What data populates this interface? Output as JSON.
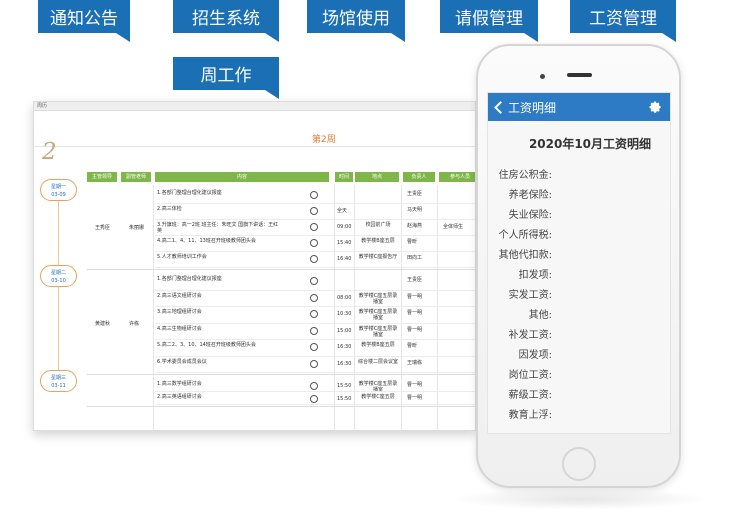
{
  "tags": [
    "通知公告",
    "招生系统",
    "场馆使用",
    "请假管理",
    "工资管理",
    "周工作"
  ],
  "screenshot": {
    "window_title": "周历",
    "week_number": "2",
    "week_label": "第2周",
    "headers": [
      "主管领导",
      "副管老师",
      "内容",
      "时间",
      "地点",
      "负责人",
      "参与人员"
    ],
    "days": [
      {
        "day": "星期一",
        "date": "03-09",
        "leader": "王秀臣",
        "teacher": "朱丽娜",
        "rows": [
          {
            "content": "1.各部门整理台理化建议报座",
            "time": "",
            "place": "",
            "owner": "王贵臣",
            "participants": ""
          },
          {
            "content": "2.高三体检",
            "time": "全天",
            "place": "",
            "owner": "马天明",
            "participants": ""
          },
          {
            "content": "3.升旗班：高一2班 班主任：朱旺文 国旗下讲话：王红英",
            "time": "09:00",
            "place": "校园前广场",
            "owner": "赵海燕",
            "participants": "全体师生"
          },
          {
            "content": "4.高二1、4、11、13班召开班级教师团头会",
            "time": "15:40",
            "place": "教学楼B座五层",
            "owner": "曹昕",
            "participants": ""
          },
          {
            "content": "5.人才教师培训工作会",
            "time": "16:40",
            "place": "教学楼C座报告厅",
            "owner": "田向工",
            "participants": ""
          }
        ]
      },
      {
        "day": "星期二",
        "date": "03-10",
        "leader": "黄建秋",
        "teacher": "许栋",
        "rows": [
          {
            "content": "1.各部门整理台理化建议报座",
            "time": "",
            "place": "",
            "owner": "王贵臣",
            "participants": ""
          },
          {
            "content": "2.高三语文组研讨会",
            "time": "08:00",
            "place": "教学楼C座五层录播室",
            "owner": "曹一明",
            "participants": ""
          },
          {
            "content": "3.高三地理组研讨会",
            "time": "10:30",
            "place": "教学楼C座五层录播室",
            "owner": "曹一明",
            "participants": ""
          },
          {
            "content": "4.高三生物组研讨会",
            "time": "15:00",
            "place": "教学楼C座五层录播室",
            "owner": "曹一明",
            "participants": ""
          },
          {
            "content": "5.高二2、3、10、14班召开班级教师团头会",
            "time": "16:30",
            "place": "教学楼B座五层",
            "owner": "曹昕",
            "participants": ""
          },
          {
            "content": "6.学术委员会成员会议",
            "time": "16:30",
            "place": "综合楼二层会议室",
            "owner": "王瑞栋",
            "participants": ""
          }
        ]
      },
      {
        "day": "星期三",
        "date": "03-11",
        "leader": "",
        "teacher": "",
        "rows": [
          {
            "content": "1.高三数学组研讨会",
            "time": "15:50",
            "place": "教学楼C座五层录播室",
            "owner": "曹一明",
            "participants": ""
          },
          {
            "content": "2.高三英语组研讨会",
            "time": "15:50",
            "place": "教学楼C座五层",
            "owner": "曹一明",
            "participants": ""
          }
        ]
      }
    ]
  },
  "phone": {
    "nav_title": "工资明细",
    "back_icon": "chevron-left-icon",
    "settings_icon": "gear-icon",
    "bar_color": "#2d7bc4",
    "salary_title": "2020年10月工资明细",
    "items": [
      "住房公积金:",
      "养老保险:",
      "失业保险:",
      "个人所得税:",
      "其他代扣款:",
      "扣发项:",
      "实发工资:",
      "其他:",
      "补发工资:",
      "因发项:",
      "岗位工资:",
      "薪级工资:",
      "教育上浮:"
    ]
  },
  "colors": {
    "tag_blue": "#1a6fb5",
    "header_green": "#7fb64a",
    "week_orange": "#e07a36",
    "badge_border": "#e8a35a"
  }
}
